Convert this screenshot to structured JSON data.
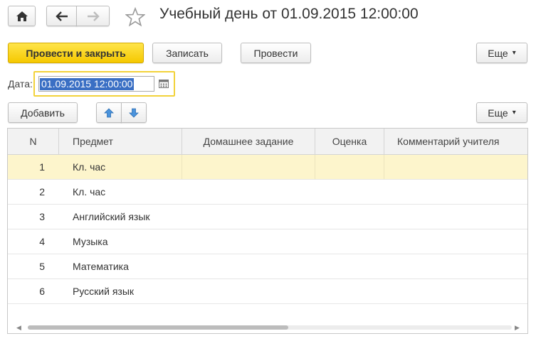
{
  "header": {
    "title": "Учебный день от 01.09.2015 12:00:00",
    "icons": {
      "home": "home-icon",
      "back": "arrow-left-icon",
      "forward": "arrow-right-icon",
      "favorite": "star-icon"
    }
  },
  "toolbar": {
    "post_close_label": "Провести и закрыть",
    "save_label": "Записать",
    "post_label": "Провести",
    "more_label": "Еще",
    "more_arrow": "▾"
  },
  "date_field": {
    "label": "Дата:",
    "value": "01.09.2015 12:00:00",
    "icon": "calendar-icon"
  },
  "table_toolbar": {
    "add_label": "Добавить",
    "move_up_icon": "arrow-up-icon",
    "move_down_icon": "arrow-down-icon",
    "more_label": "Еще",
    "more_arrow": "▾"
  },
  "table": {
    "columns": [
      "N",
      "Предмет",
      "Домашнее задание",
      "Оценка",
      "Комментарий учителя"
    ],
    "rows": [
      {
        "n": "1",
        "subject": "Кл. час"
      },
      {
        "n": "2",
        "subject": "Кл. час"
      },
      {
        "n": "3",
        "subject": "Английский язык"
      },
      {
        "n": "4",
        "subject": "Музыка"
      },
      {
        "n": "5",
        "subject": "Математика"
      },
      {
        "n": "6",
        "subject": "Русский язык"
      }
    ],
    "scroll_left": "◀",
    "scroll_right": "▶"
  },
  "colors": {
    "primary_button": "#f5c800",
    "focus_border": "#f2d23a",
    "selection": "#3a6fc4",
    "active_row": "#fdf5cc",
    "nav_arrow_blue": "#3e8ad6"
  }
}
